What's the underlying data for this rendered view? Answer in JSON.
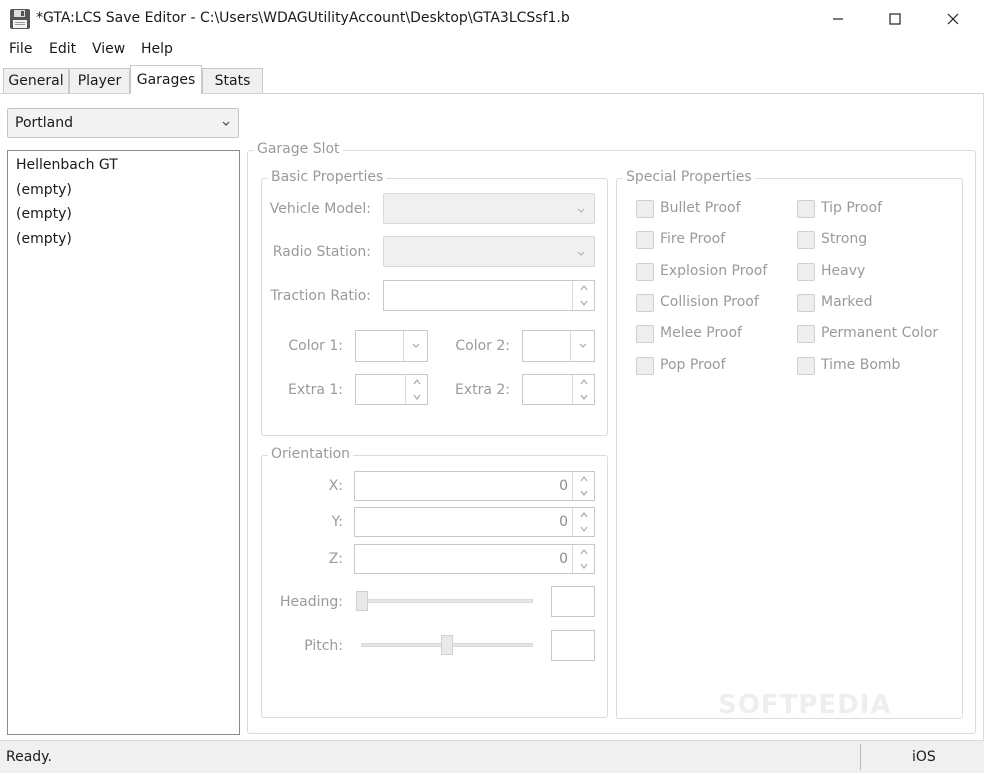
{
  "window": {
    "title": "*GTA:LCS Save Editor - C:\\Users\\WDAGUtilityAccount\\Desktop\\GTA3LCSsf1.b",
    "icon": "floppy-disk-icon"
  },
  "menu": {
    "items": [
      {
        "label": "File"
      },
      {
        "label": "Edit"
      },
      {
        "label": "View"
      },
      {
        "label": "Help"
      }
    ]
  },
  "tabs": [
    {
      "label": "General",
      "active": false
    },
    {
      "label": "Player",
      "active": false
    },
    {
      "label": "Garages",
      "active": true
    },
    {
      "label": "Stats",
      "active": false
    }
  ],
  "garages": {
    "region": {
      "selected": "Portland"
    },
    "slots": [
      "Hellenbach GT",
      "(empty)",
      "(empty)",
      "(empty)"
    ]
  },
  "garage_slot": {
    "title": "Garage Slot",
    "basic": {
      "title": "Basic Properties",
      "vehicle_model_label": "Vehicle Model:",
      "radio_station_label": "Radio Station:",
      "traction_ratio_label": "Traction Ratio:",
      "color1_label": "Color 1:",
      "color2_label": "Color 2:",
      "extra1_label": "Extra 1:",
      "extra2_label": "Extra 2:"
    },
    "orientation": {
      "title": "Orientation",
      "x_label": "X:",
      "x_value": "0",
      "y_label": "Y:",
      "y_value": "0",
      "z_label": "Z:",
      "z_value": "0",
      "heading_label": "Heading:",
      "heading_level": 0,
      "pitch_label": "Pitch:",
      "pitch_level": 0.5
    },
    "special": {
      "title": "Special Properties",
      "left": [
        "Bullet Proof",
        "Fire Proof",
        "Explosion Proof",
        "Collision Proof",
        "Melee Proof",
        "Pop Proof"
      ],
      "right": [
        "Tip Proof",
        "Strong",
        "Heavy",
        "Marked",
        "Permanent Color",
        "Time Bomb"
      ]
    }
  },
  "status": {
    "text": "Ready.",
    "platform": "iOS"
  },
  "watermark": "SOFTPEDIA"
}
